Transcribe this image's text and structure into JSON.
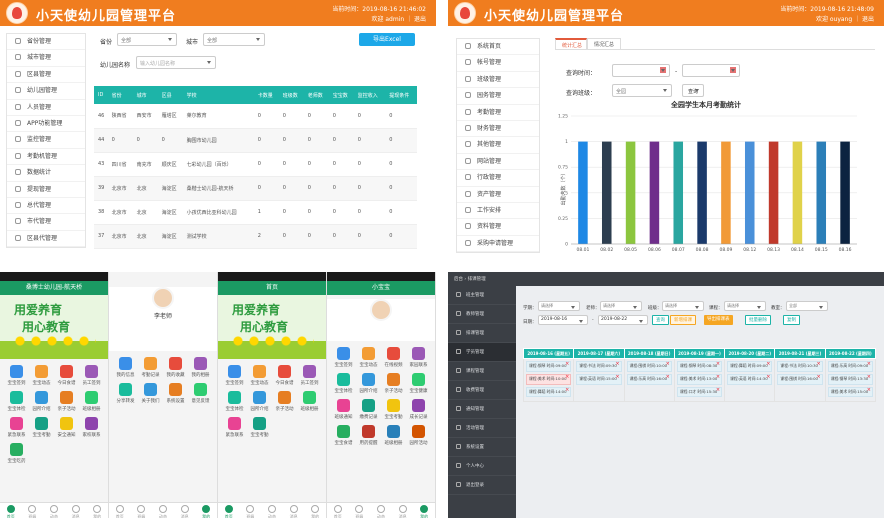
{
  "app": {
    "title": "小天使幼儿园管理平台",
    "colors": {
      "orange": "#f07d1f",
      "teal": "#1db4a8",
      "blue": "#1da8e8",
      "green": "#1b9a63",
      "dark": "#3b3f45",
      "red": "#e25a3b"
    }
  },
  "panel1": {
    "time": "当前时间：2019-08-16 21:46:02",
    "welcome": "欢迎 admin ｜ 退出",
    "sidebar": [
      "省份管理",
      "城市管理",
      "区县管理",
      "幼儿园管理",
      "人员管理",
      "APP功能管理",
      "监控管理",
      "考勤机管理",
      "数据统计",
      "提现管理",
      "总代管理",
      "市代管理",
      "区县代管理"
    ],
    "filters": {
      "province_label": "省份",
      "province_value": "全部",
      "city_label": "城市",
      "city_value": "全部",
      "name_label": "幼儿园名称",
      "name_placeholder": "输入幼儿园名称"
    },
    "export_button": "导出Excel",
    "table": {
      "headers": [
        "ID",
        "省份",
        "城市",
        "区县",
        "学校",
        "卡数量",
        "班级数",
        "老师数",
        "宝宝数",
        "监控收入",
        "提现条件"
      ],
      "rows": [
        [
          "46",
          "陕西省",
          "西安市",
          "雁塔区",
          "莱尔教育",
          "0",
          "0",
          "0",
          "0",
          "0",
          "0"
        ],
        [
          "44",
          "0",
          "0",
          "0",
          "胸围市幼儿园",
          "0",
          "0",
          "0",
          "0",
          "0",
          "0"
        ],
        [
          "43",
          "四川省",
          "南充市",
          "顺庆区",
          "七彩幼儿园（百烁）",
          "0",
          "0",
          "0",
          "0",
          "0",
          "0"
        ],
        [
          "39",
          "北京市",
          "北京",
          "海淀区",
          "桑楷士幼儿园-航天桥",
          "0",
          "0",
          "0",
          "0",
          "0",
          "0"
        ],
        [
          "38",
          "北京市",
          "北京",
          "海淀区",
          "小孩优西比亚科幼儿园",
          "1",
          "0",
          "0",
          "0",
          "0",
          "0"
        ],
        [
          "37",
          "北京市",
          "北京",
          "海淀区",
          "测试学校",
          "2",
          "0",
          "0",
          "0",
          "0",
          "0"
        ]
      ]
    }
  },
  "panel2": {
    "time": "当前时间：2019-08-16 21:48:09",
    "welcome": "欢迎 ouyang ｜ 退出",
    "sidebar": [
      "系统首页",
      "帐号管理",
      "班级管理",
      "园务管理",
      "考勤管理",
      "财务管理",
      "其他管理",
      "网站管理",
      "行政管理",
      "资产管理",
      "工作安排",
      "资料管理",
      "采购申请管理"
    ],
    "tabs": [
      "统计汇总",
      "情况汇总"
    ],
    "form": {
      "query_label": "查询时间：",
      "category_label": "查询班级：",
      "category_value": "全园",
      "search_button": "查询"
    }
  },
  "chart_data": {
    "type": "bar",
    "title": "全园学生本月考勤统计",
    "ylabel": "出勤人数（个）",
    "ylim": [
      0,
      1.25
    ],
    "yticks": [
      "1.25",
      "1",
      "0.75",
      "0.5",
      "0.25",
      "0"
    ],
    "categories": [
      "08.01",
      "08.02",
      "08.05",
      "08.06",
      "08.07",
      "08.08",
      "08.09",
      "08.12",
      "08.13",
      "08.14",
      "08.15",
      "08.16"
    ],
    "values": [
      1,
      1,
      1,
      1,
      1,
      1,
      1,
      1,
      1,
      1,
      1,
      1
    ],
    "colors": [
      "#1e88e5",
      "#2d3e50",
      "#8cc63f",
      "#6f2e8b",
      "#2aa6a0",
      "#1b3a6b",
      "#f19a38",
      "#4a90d9",
      "#c0392b",
      "#e0d24a",
      "#2c7fb8",
      "#0c2340"
    ]
  },
  "panel3": {
    "phone1": {
      "title": "桑博士幼儿园-航天桥",
      "banner1": "用爱养育",
      "banner2": "用心教育",
      "items": [
        "宝宝签到",
        "宝宝动态",
        "今日食谱",
        "员工签到",
        "宝宝体检",
        "园所介绍",
        "亲子活动",
        "班级相册",
        "紧急联系",
        "宝宝考勤",
        "安全通知",
        "家校联系",
        "宝宝吃药"
      ],
      "tabbar": [
        "首页",
        "班级",
        "动态",
        "消息",
        "我的"
      ]
    },
    "phone2": {
      "name": "李老师",
      "items": [
        "我的信息",
        "考勤记录",
        "我的收藏",
        "我的相册",
        "分享转发",
        "关于我们",
        "系统设置",
        "意见反馈"
      ],
      "tabbar": [
        "首页",
        "班级",
        "动态",
        "消息",
        "我的"
      ]
    },
    "phone3": {
      "title": "首页",
      "banner1": "用爱养育",
      "banner2": "用心教育",
      "items": [
        "宝宝签到",
        "宝宝动态",
        "今日食谱",
        "员工签到",
        "宝宝体检",
        "园所介绍",
        "亲子活动",
        "班级相册",
        "紧急联系",
        "宝宝考勤"
      ],
      "tabbar": [
        "首页",
        "班级",
        "动态",
        "消息",
        "我的"
      ]
    },
    "phone4": {
      "title": "小宝宝",
      "items": [
        "宝宝签到",
        "宝宝动态",
        "在线视频",
        "家园联系",
        "宝宝体检",
        "园所介绍",
        "亲子活动",
        "宝宝健康",
        "班级通知",
        "缴费记录",
        "宝宝考勤",
        "成长记录",
        "宝宝食谱",
        "用药提醒",
        "班级相册",
        "园所活动"
      ],
      "tabbar": [
        "首页",
        "班级",
        "动态",
        "消息",
        "我的"
      ]
    }
  },
  "panel4": {
    "top_title": "后台 › 排课管理",
    "sidebar": [
      "班主管理",
      "教师管理",
      "排课管理",
      "学员管理",
      "课程管理",
      "收费管理",
      "通知管理",
      "活动管理",
      "系统设置",
      "个人中心",
      "退出登录"
    ],
    "filters": {
      "f1_label": "学期：",
      "f1_value": "请选择",
      "f2_label": "老师：",
      "f2_value": "请选择",
      "f3_label": "班级：",
      "f3_value": "请选择",
      "f4_label": "课程：",
      "f4_value": "请选择",
      "f5_label": "教室：",
      "f5_value": "全部",
      "date_label": "日期：",
      "date_from": "2019-08-16",
      "date_to": "2019-08-22"
    },
    "buttons": [
      "查询",
      "新增排课",
      "导出排课表",
      "批量删除",
      "复制"
    ],
    "days": [
      "2019-08-16 (星期五)",
      "2019-08-17 (星期六)",
      "2019-08-18 (星期日)",
      "2019-08-19 (星期一)",
      "2019-08-20 (星期二)",
      "2019-08-21 (星期三)",
      "2019-08-22 (星期四)"
    ],
    "cards": [
      [
        "课程:钢琴 时间:09:00",
        "课程:美术 时间:10:00",
        "课程:舞蹈 时间:14:00"
      ],
      [
        "课程:书法 时间:09:30",
        "课程:英语 时间:15:00"
      ],
      [
        "课程:围棋 时间:10:00",
        "课程:乐高 时间:16:00"
      ],
      [
        "课程:钢琴 时间:08:30",
        "课程:美术 时间:13:00",
        "课程:口才 时间:15:30"
      ],
      [
        "课程:舞蹈 时间:09:00",
        "课程:英语 时间:14:30"
      ],
      [
        "课程:书法 时间:10:30",
        "课程:围棋 时间:16:00"
      ],
      [
        "课程:乐高 时间:09:00",
        "课程:钢琴 时间:13:30",
        "课程:美术 时间:15:00"
      ]
    ]
  }
}
